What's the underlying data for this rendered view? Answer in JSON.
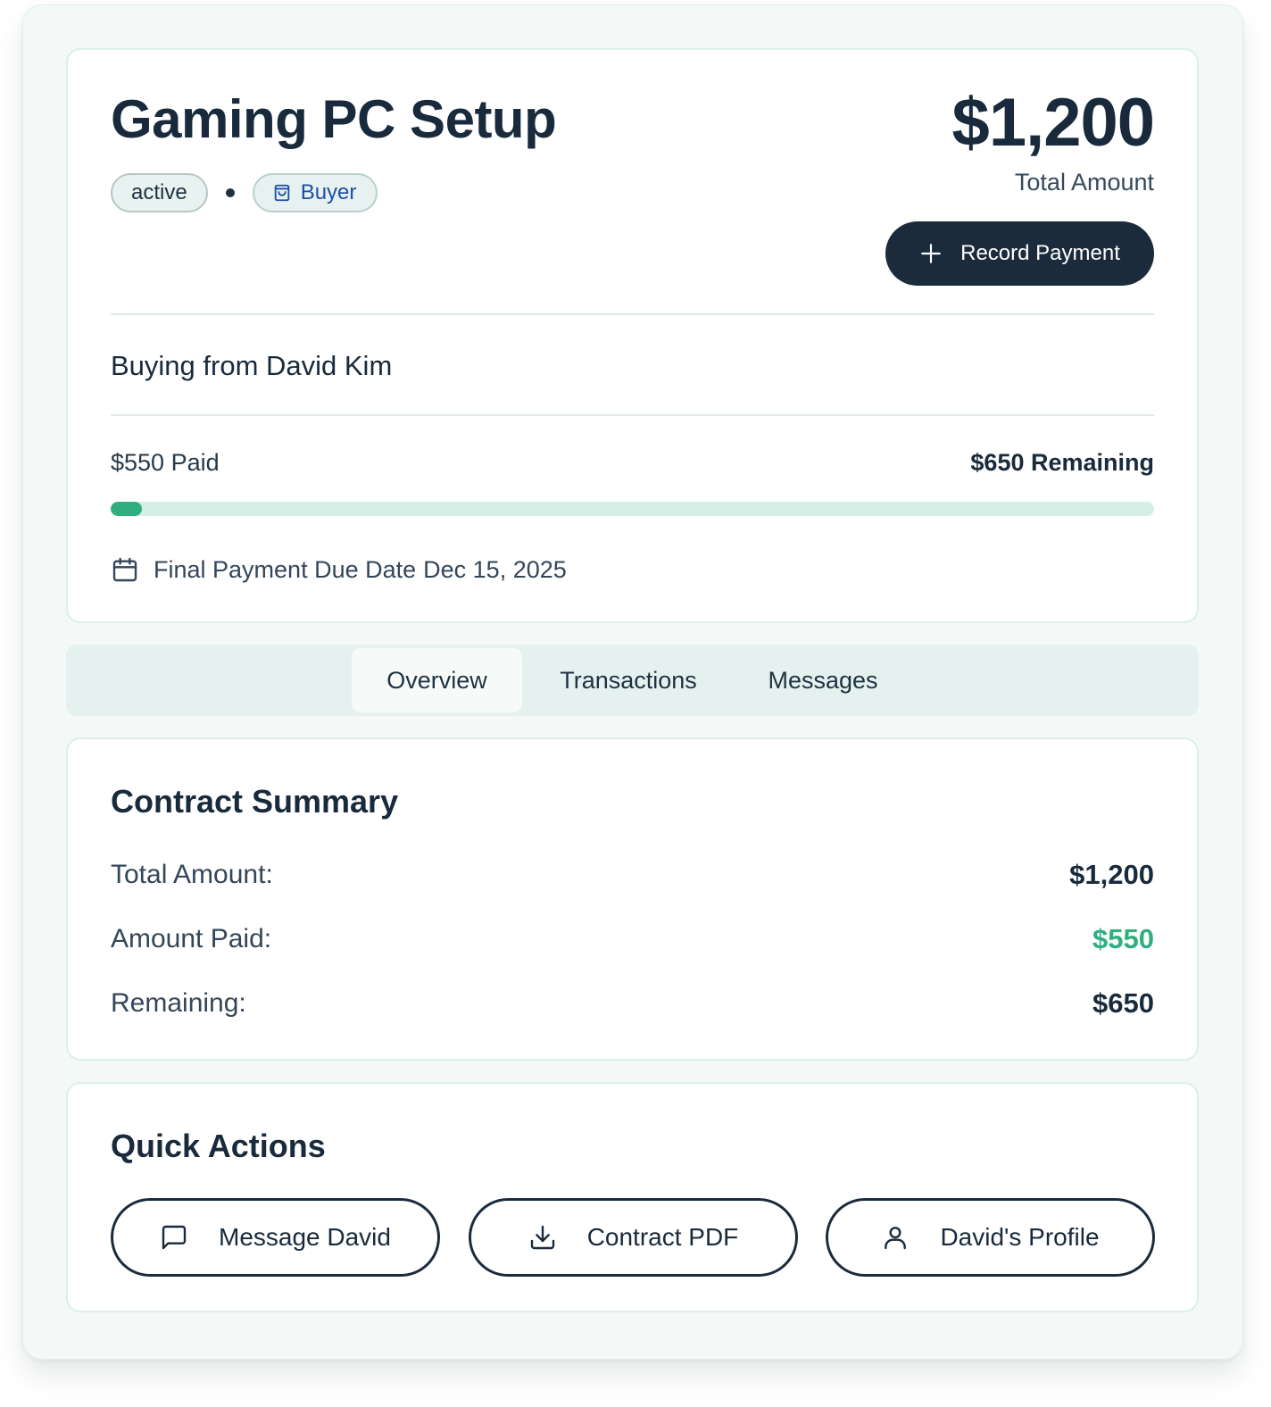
{
  "contract": {
    "title": "Gaming PC Setup",
    "status": "active",
    "role": "Buyer",
    "total_amount": "$1,200",
    "total_caption": "Total Amount",
    "record_payment_label": "Record Payment",
    "counterparty_text": "Buying from David Kim",
    "paid_text": "$550 Paid",
    "remaining_text": "$650 Remaining",
    "progress_fraction": 0.03,
    "due_label": "Final Payment Due Date",
    "due_date": "Dec 15, 2025"
  },
  "tabs": [
    {
      "label": "Overview",
      "active": true
    },
    {
      "label": "Transactions",
      "active": false
    },
    {
      "label": "Messages",
      "active": false
    }
  ],
  "summary": {
    "title": "Contract Summary",
    "rows": [
      {
        "label": "Total Amount:",
        "value": "$1,200"
      },
      {
        "label": "Amount Paid:",
        "value": "$550"
      },
      {
        "label": "Remaining:",
        "value": "$650"
      }
    ]
  },
  "quick_actions": {
    "title": "Quick Actions",
    "buttons": [
      {
        "label": "Message David",
        "icon": "message-square-icon"
      },
      {
        "label": "Contract PDF",
        "icon": "download-icon"
      },
      {
        "label": "David's Profile",
        "icon": "user-icon"
      }
    ]
  },
  "colors": {
    "primary_dark": "#1b2b3c",
    "accent_green": "#2fae7f",
    "role_blue": "#1d4fa8",
    "track": "#d6efe6"
  }
}
